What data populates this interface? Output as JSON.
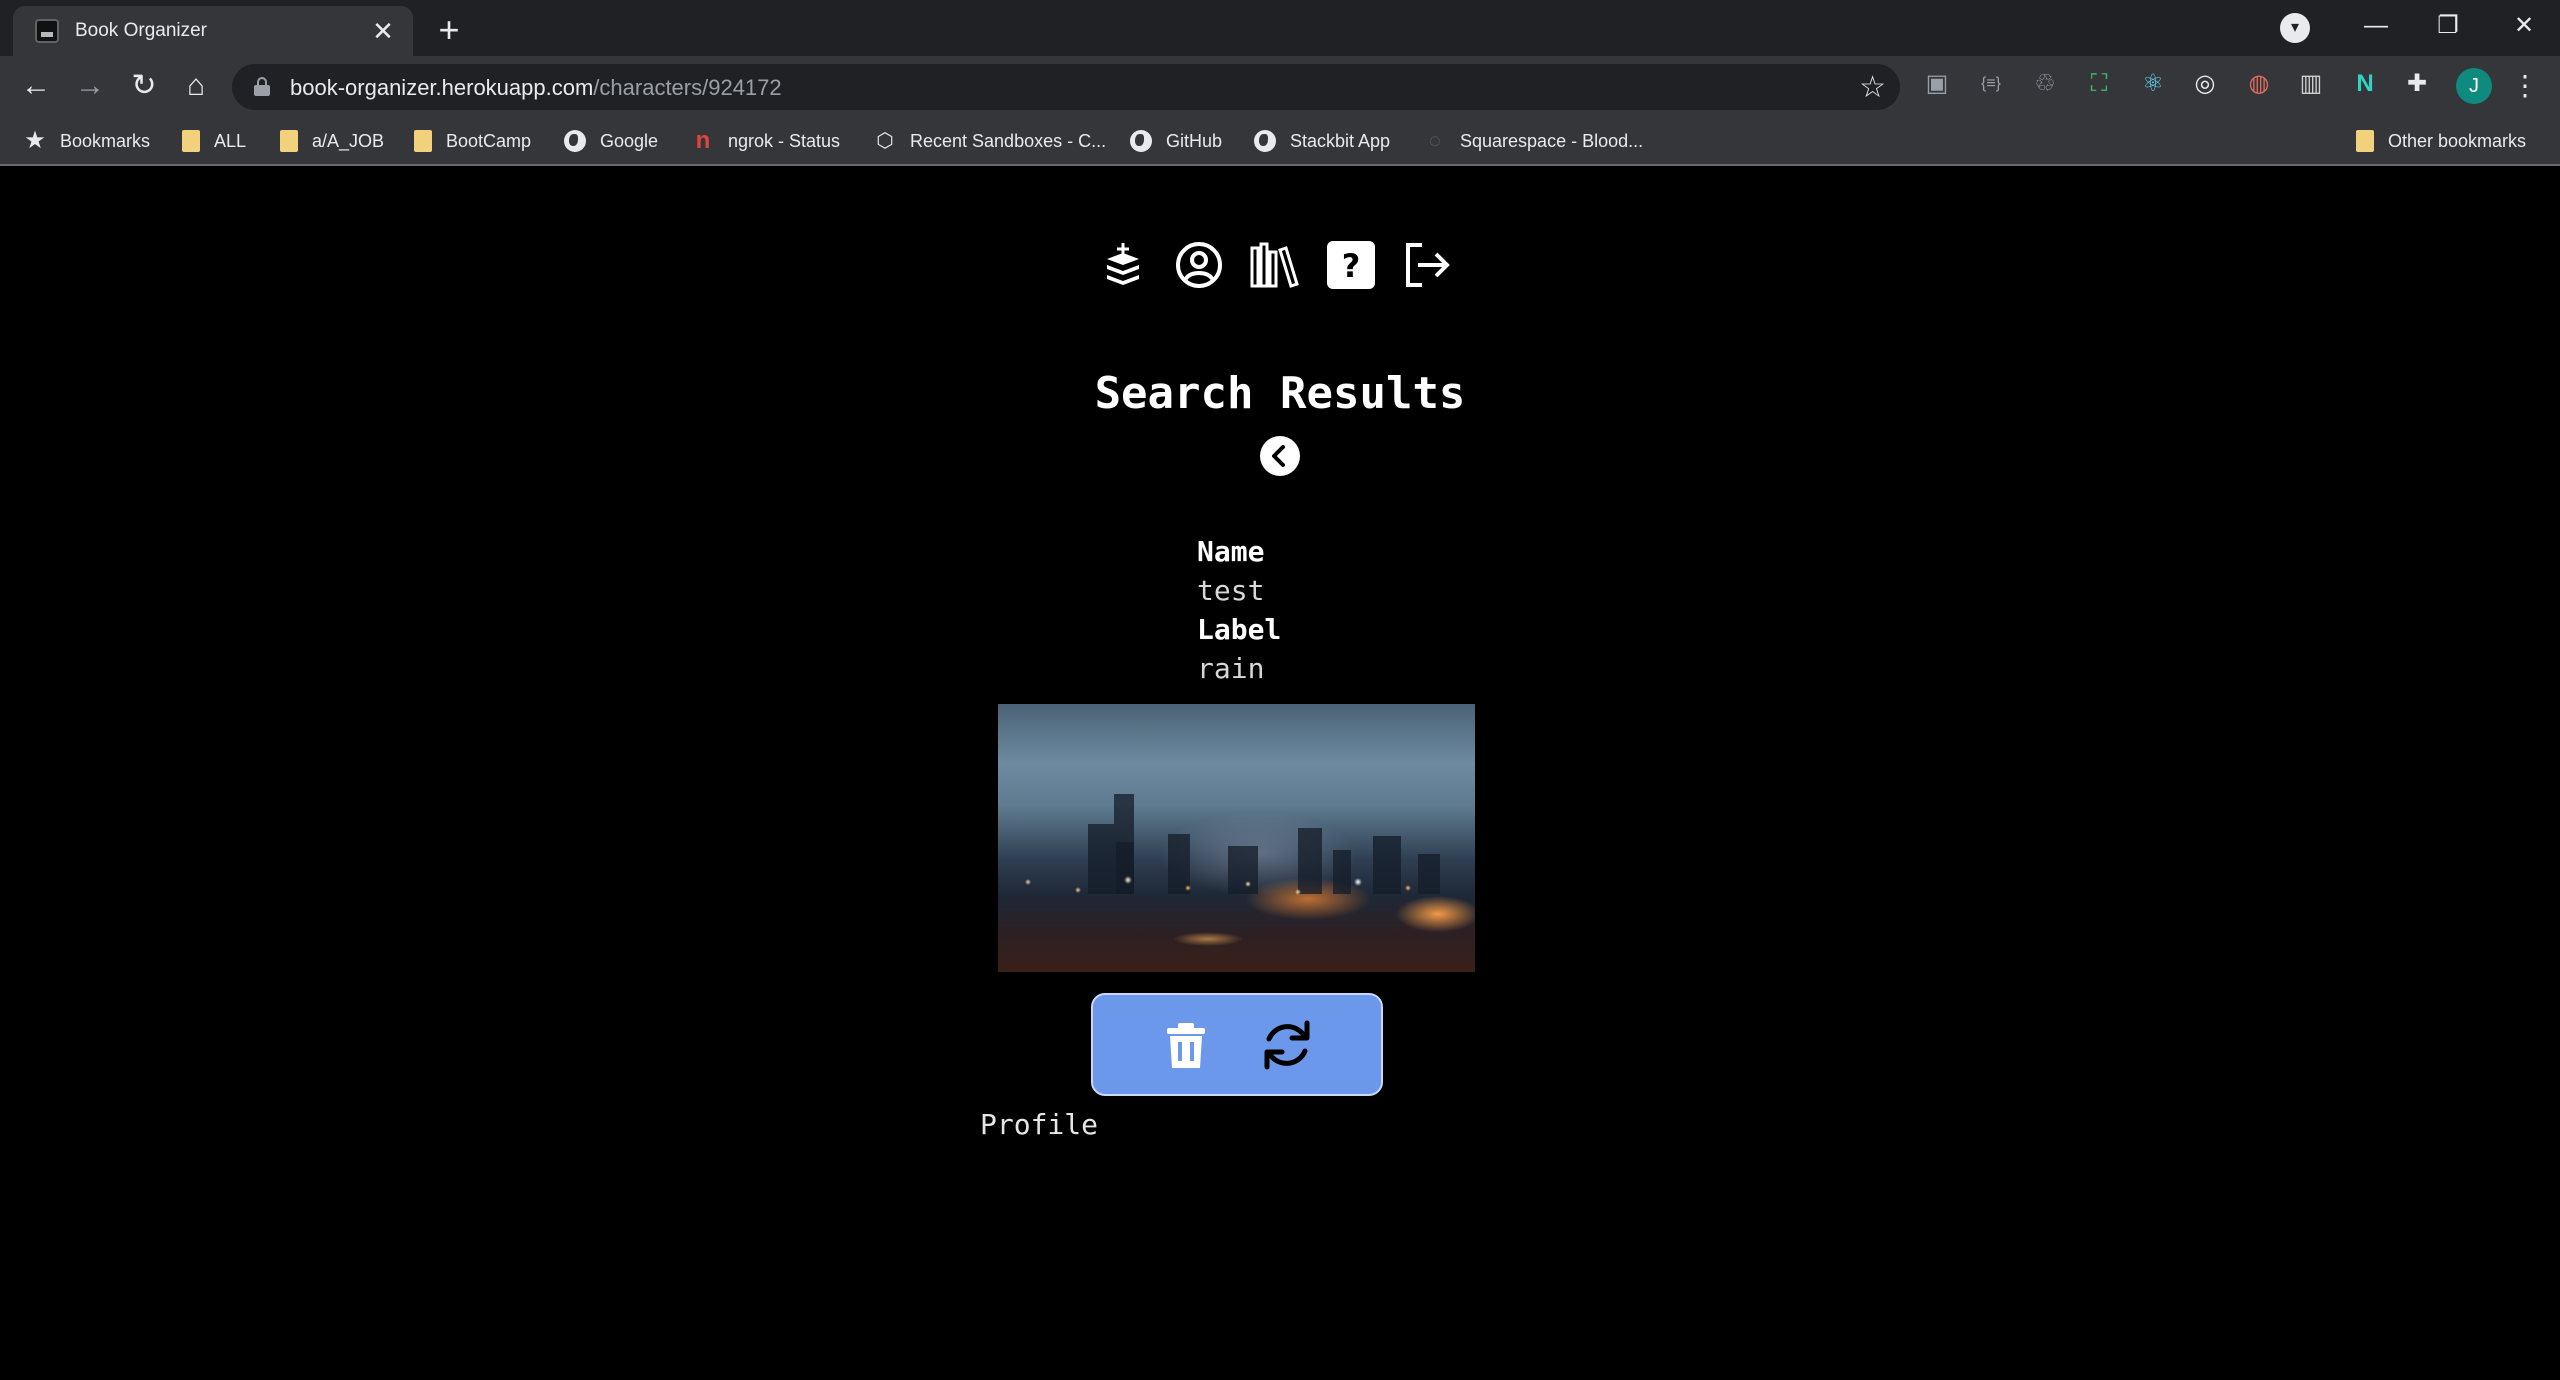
{
  "browser": {
    "tab_title": "Book Organizer",
    "tab_close": "✕",
    "new_tab": "+",
    "url_host": "book-organizer.herokuapp.com",
    "url_path": "/characters/924172",
    "profile_initial": "J",
    "bookmarks": [
      {
        "label": "Bookmarks",
        "icon": "star-icon"
      },
      {
        "label": "ALL",
        "icon": "folder-icon"
      },
      {
        "label": "a/A_JOB",
        "icon": "folder-icon"
      },
      {
        "label": "BootCamp",
        "icon": "folder-icon"
      },
      {
        "label": "Google",
        "icon": "globe-icon"
      },
      {
        "label": "ngrok - Status",
        "icon": "ngrok-icon"
      },
      {
        "label": "Recent Sandboxes - C...",
        "icon": "codesandbox-icon"
      },
      {
        "label": "GitHub",
        "icon": "github-icon"
      },
      {
        "label": "Stackbit App",
        "icon": "globe-icon"
      },
      {
        "label": "Squarespace - Blood...",
        "icon": "squarespace-icon"
      }
    ],
    "other_bookmarks": "Other bookmarks"
  },
  "app": {
    "nav": [
      {
        "name": "add-book-icon"
      },
      {
        "name": "profile-icon"
      },
      {
        "name": "library-icon"
      },
      {
        "name": "help-icon"
      },
      {
        "name": "logout-icon"
      }
    ],
    "title": "Search Results",
    "fields": {
      "name_label": "Name",
      "name_value": "test",
      "label_label": "Label",
      "label_value": "rain"
    },
    "image_description_icon": "rainy-city-image",
    "actions": {
      "delete_icon": "trash-icon",
      "refresh_icon": "refresh-icon",
      "bar_color": "#6b98ea"
    },
    "profile_link": "Profile"
  }
}
